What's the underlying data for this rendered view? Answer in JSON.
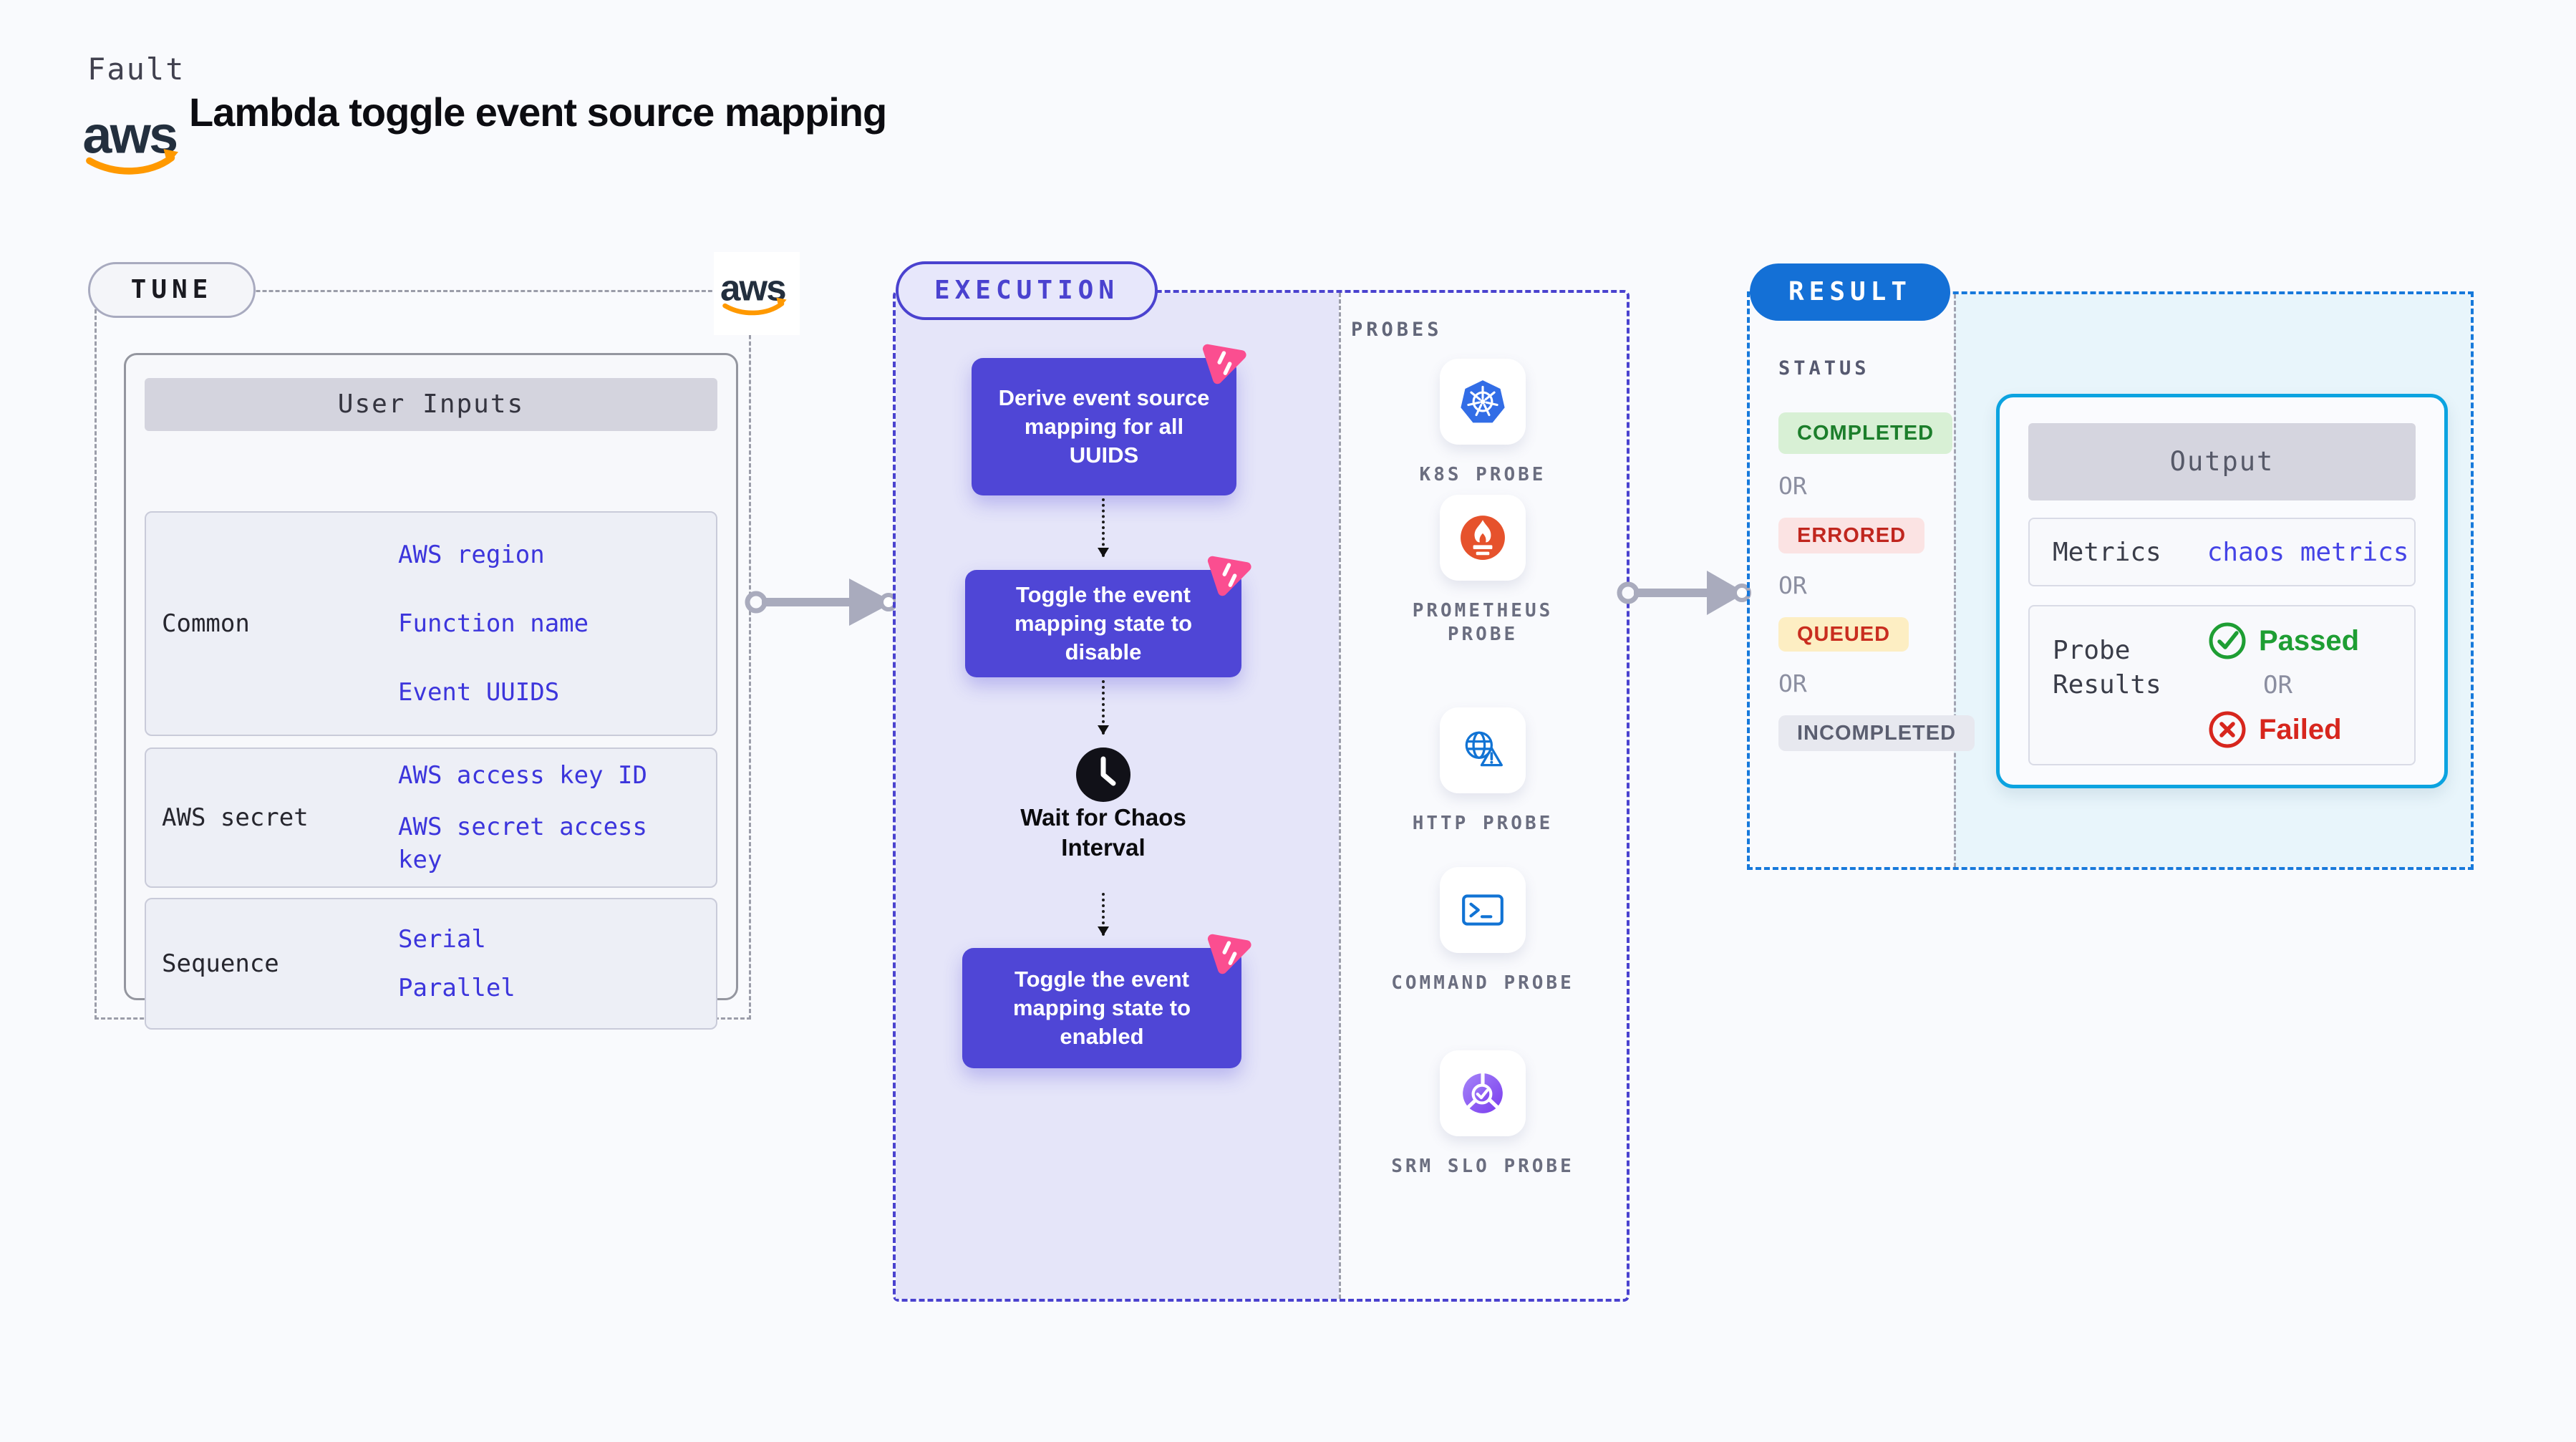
{
  "header": {
    "kicker": "Fault",
    "title": "Lambda toggle event source mapping"
  },
  "logos": {
    "aws_text": "aws"
  },
  "tune": {
    "pill": "TUNE",
    "table": {
      "header": "User Inputs",
      "rows": [
        {
          "label": "Common",
          "values": [
            "AWS region",
            "Function name",
            "Event UUIDS"
          ]
        },
        {
          "label": "AWS secret",
          "values": [
            "AWS access key ID",
            "AWS secret access key"
          ]
        },
        {
          "label": "Sequence",
          "values": [
            "Serial",
            "Parallel"
          ]
        }
      ]
    }
  },
  "execution": {
    "pill": "EXECUTION",
    "nodes": [
      {
        "label": "Derive event source mapping for all UUIDS"
      },
      {
        "label": "Toggle the event mapping state to disable"
      },
      {
        "label": "Toggle the event mapping state to enabled"
      }
    ],
    "wait_label": "Wait for Chaos Interval",
    "probes": {
      "title": "PROBES",
      "items": [
        {
          "icon": "kubernetes-icon",
          "label": "K8S PROBE"
        },
        {
          "icon": "prometheus-icon",
          "label": "PROMETHEUS PROBE"
        },
        {
          "icon": "http-globe-icon",
          "label": "HTTP PROBE"
        },
        {
          "icon": "terminal-icon",
          "label": "COMMAND PROBE"
        },
        {
          "icon": "srm-slo-icon",
          "label": "SRM SLO PROBE"
        }
      ]
    }
  },
  "result": {
    "pill": "RESULT",
    "status": {
      "title": "STATUS",
      "items": [
        {
          "label": "COMPLETED",
          "type": "success"
        },
        {
          "label": "OR",
          "type": "or"
        },
        {
          "label": "ERRORED",
          "type": "error"
        },
        {
          "label": "OR",
          "type": "or"
        },
        {
          "label": "QUEUED",
          "type": "warning"
        },
        {
          "label": "OR",
          "type": "or"
        },
        {
          "label": "INCOMPLETED",
          "type": "neutral"
        }
      ]
    },
    "output": {
      "header": "Output",
      "metrics_label": "Metrics",
      "metrics_value": "chaos metrics",
      "probe_results_label": "Probe Results",
      "passed": "Passed",
      "or": "OR",
      "failed": "Failed"
    }
  },
  "colors": {
    "indigo": "#4a42cf",
    "node_fill": "#4f46d6",
    "lavender_fill": "#e5e5f9",
    "result_blue": "#1470d6",
    "cyan_border": "#0ba3e0",
    "cyan_fill": "#e8f5fb",
    "value_blue": "#3c35dc",
    "pink": "#fb4e90",
    "green": "#1e9e33",
    "red": "#d7261d",
    "warning_bg": "#fdeec3",
    "success_bg": "#d8f0d5",
    "error_bg": "#fbe3e3",
    "aws_orange": "#ff9900",
    "aws_dark": "#232f3e"
  }
}
